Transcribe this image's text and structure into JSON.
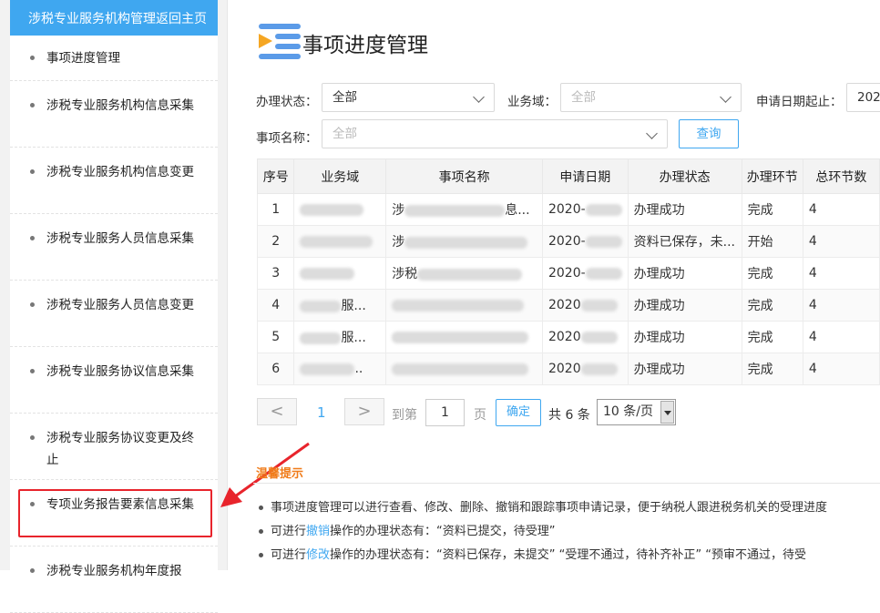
{
  "sidebar": {
    "header": "涉税专业服务机构管理返回主页",
    "items": [
      {
        "label": "事项进度管理"
      },
      {
        "label": "涉税专业服务机构信息采集"
      },
      {
        "label": "涉税专业服务机构信息变更"
      },
      {
        "label": "涉税专业服务人员信息采集"
      },
      {
        "label": "涉税专业服务人员信息变更"
      },
      {
        "label": "涉税专业服务协议信息采集"
      },
      {
        "label": "涉税专业服务协议变更及终止"
      },
      {
        "label": "专项业务报告要素信息采集"
      },
      {
        "label": "涉税专业服务机构年度报"
      }
    ]
  },
  "page": {
    "title": "事项进度管理"
  },
  "filters": {
    "status_label": "办理状态：",
    "status_value": "全部",
    "domain_label": "业务域：",
    "domain_placeholder": "全部",
    "date_label": "申请日期起止：",
    "date_value": "202",
    "name_label": "事项名称：",
    "name_placeholder": "全部",
    "query_button": "查询"
  },
  "table": {
    "headers": [
      "序号",
      "业务域",
      "事项名称",
      "申请日期",
      "办理状态",
      "办理环节",
      "总环节数"
    ],
    "rows": [
      {
        "no": "1",
        "domain": "",
        "name": "涉",
        "name_tail": "息...",
        "date": "2020-",
        "status": "办理成功",
        "step": "完成",
        "total": "4"
      },
      {
        "no": "2",
        "domain": "",
        "name": "涉",
        "name_tail": "",
        "date": "2020-",
        "status": "资料已保存，未...",
        "step": "开始",
        "total": "4"
      },
      {
        "no": "3",
        "domain": "",
        "name": "涉税",
        "name_tail": "",
        "date": "2020-",
        "status": "办理成功",
        "step": "完成",
        "total": "4"
      },
      {
        "no": "4",
        "domain": "服...",
        "name": "",
        "name_tail": "",
        "date": "2020",
        "status": "办理成功",
        "step": "完成",
        "total": "4"
      },
      {
        "no": "5",
        "domain": "服...",
        "name": "",
        "name_tail": "",
        "date": "2020",
        "status": "办理成功",
        "step": "完成",
        "total": "4"
      },
      {
        "no": "6",
        "domain": "..",
        "name": "",
        "name_tail": "",
        "date": "2020",
        "status": "办理成功",
        "step": "完成",
        "total": "4"
      }
    ]
  },
  "pagination": {
    "prev": "<",
    "current": "1",
    "next": ">",
    "goto_label": "到第",
    "goto_value": "1",
    "page_label": "页",
    "ok_button": "确定",
    "total": "共 6 条",
    "page_size": "10 条/页"
  },
  "tips": {
    "title": "温馨提示",
    "line1": "事项进度管理可以进行查看、修改、删除、撤销和跟踪事项申请记录，便于纳税人跟进税务机关的受理进度",
    "line2_pre": "可进行",
    "line2_link": "撤销",
    "line2_post": "操作的办理状态有：“资料已提交，待受理”",
    "line3_pre": "可进行",
    "line3_link": "修改",
    "line3_post": "操作的办理状态有：“资料已保存，未提交” “受理不通过，待补齐补正” “预审不通过，待受"
  }
}
